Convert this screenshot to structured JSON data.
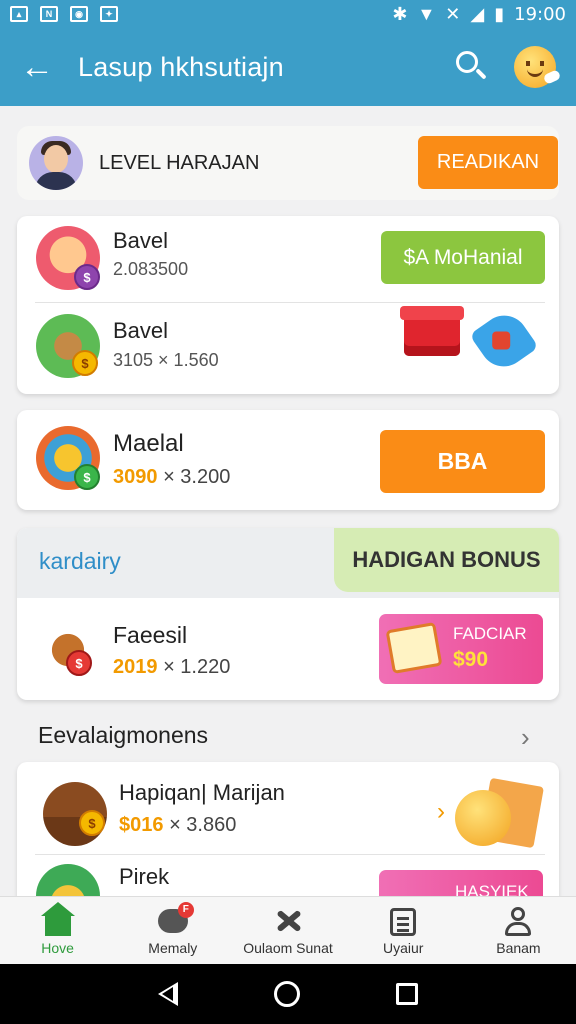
{
  "status_bar": {
    "time": "19:00",
    "left_icons": [
      "image-icon",
      "n-icon",
      "map-icon",
      "bag-icon"
    ],
    "right_icons": [
      "bluetooth-icon",
      "wifi-icon",
      "mute-icon",
      "signal-icon",
      "battery-icon"
    ]
  },
  "app_bar": {
    "title": "Lasup hkhsutiajn",
    "back_icon": "arrow-left-icon",
    "search_icon": "search-icon",
    "profile_icon": "smiley-icon"
  },
  "level_row": {
    "label": "LEVEL HARAJAN",
    "button": "READIKAN"
  },
  "card1": {
    "row1": {
      "name": "Bavel",
      "sub": "2.083500",
      "button": "$A MoHanial"
    },
    "row2": {
      "name": "Bavel",
      "sub": "3105 × 1.560"
    }
  },
  "card2": {
    "name": "Maelal",
    "price": "3090",
    "times": "× 3.200",
    "button": "BBA"
  },
  "card3": {
    "label": "kardairy",
    "bonus": "HADIGAN BONUS",
    "item": {
      "name": "Faeesil",
      "price": "2019",
      "times": "× 1.220"
    },
    "promo": {
      "line1": "FADCIAR",
      "line2": "$90"
    }
  },
  "section": {
    "title": "Eevalaigmonens",
    "chevron": "›"
  },
  "card4": {
    "row1": {
      "name": "Hapiqan| Marijan",
      "price": "$016",
      "times": "× 3.860",
      "arrow": "›"
    },
    "row2": {
      "name": "Pirek",
      "promo": "HASYIEK"
    }
  },
  "bottom_nav": {
    "items": [
      {
        "label": "Hove",
        "icon": "home-icon"
      },
      {
        "label": "Memaly",
        "icon": "chat-icon",
        "badge": "F"
      },
      {
        "label": "Oulaom Sunat",
        "icon": "tools-icon"
      },
      {
        "label": "Uyaiur",
        "icon": "clipboard-icon"
      },
      {
        "label": "Banam",
        "icon": "user-icon"
      }
    ]
  },
  "colors": {
    "primary": "#3c9ec8",
    "orange": "#fa8c16",
    "green": "#8cc63f",
    "pink": "#ec4a93",
    "nav_active": "#2e9b3c"
  }
}
